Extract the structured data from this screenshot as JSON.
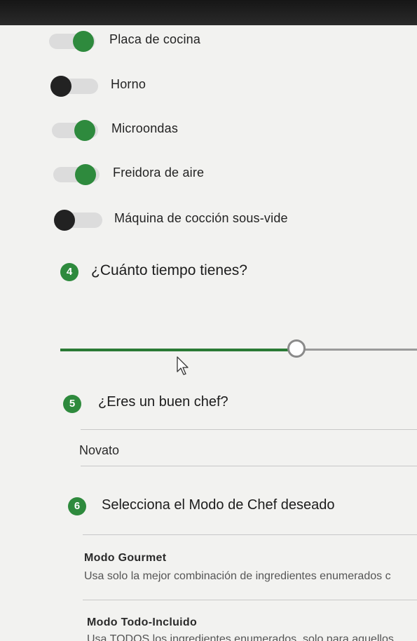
{
  "appliances": [
    {
      "label": "Placa de cocina",
      "on": true
    },
    {
      "label": "Horno",
      "on": false
    },
    {
      "label": "Microondas",
      "on": true
    },
    {
      "label": "Freidora de aire",
      "on": true
    },
    {
      "label": "Máquina de cocción sous-vide",
      "on": false
    }
  ],
  "time_section": {
    "step": "4",
    "title": "¿Cuánto tiempo tienes?",
    "slider_level_fraction": 0.67
  },
  "skill_section": {
    "step": "5",
    "title": "¿Eres un buen chef?",
    "selected_value": "Novato"
  },
  "mode_section": {
    "step": "6",
    "title": "Selecciona el Modo de Chef deseado",
    "modes": [
      {
        "title": "Modo Gourmet",
        "description": "Usa solo la mejor combinación de ingredientes enumerados c"
      },
      {
        "title": "Modo Todo-Incluido",
        "description": "Usa TODOS los ingredientes enumerados, solo para aquellos"
      }
    ]
  },
  "colors": {
    "accent": "#2e8a3d",
    "toggle_on": "#2e8a3d",
    "toggle_off": "#222222"
  }
}
